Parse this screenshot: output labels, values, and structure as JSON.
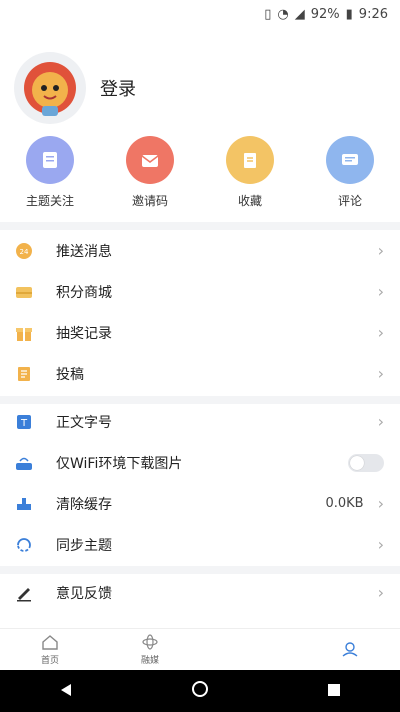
{
  "status": {
    "battery": "92%",
    "time": "9:26"
  },
  "profile": {
    "login": "登录"
  },
  "quick": [
    {
      "label": "主题关注",
      "color": "#9aa8f0",
      "icon": "topic-follow-icon"
    },
    {
      "label": "邀请码",
      "color": "#ef7665",
      "icon": "invite-code-icon"
    },
    {
      "label": "收藏",
      "color": "#f3c465",
      "icon": "favorite-icon"
    },
    {
      "label": "评论",
      "color": "#8fb6ee",
      "icon": "comment-icon"
    }
  ],
  "menu1": [
    {
      "label": "推送消息",
      "icon": "push-message-icon"
    },
    {
      "label": "积分商城",
      "icon": "points-mall-icon"
    },
    {
      "label": "抽奖记录",
      "icon": "lottery-record-icon"
    },
    {
      "label": "投稿",
      "icon": "submit-article-icon"
    }
  ],
  "menu2": [
    {
      "label": "正文字号",
      "icon": "font-size-icon"
    },
    {
      "label": "仅WiFi环境下载图片",
      "icon": "wifi-download-icon"
    },
    {
      "label": "清除缓存",
      "value": "0.0KB",
      "icon": "clear-cache-icon"
    },
    {
      "label": "同步主题",
      "icon": "sync-topic-icon"
    }
  ],
  "menu3": [
    {
      "label": "意见反馈",
      "icon": "feedback-icon"
    }
  ],
  "tabs": [
    {
      "label": "首页",
      "icon": "home-icon"
    },
    {
      "label": "融媒",
      "icon": "media-icon"
    }
  ]
}
